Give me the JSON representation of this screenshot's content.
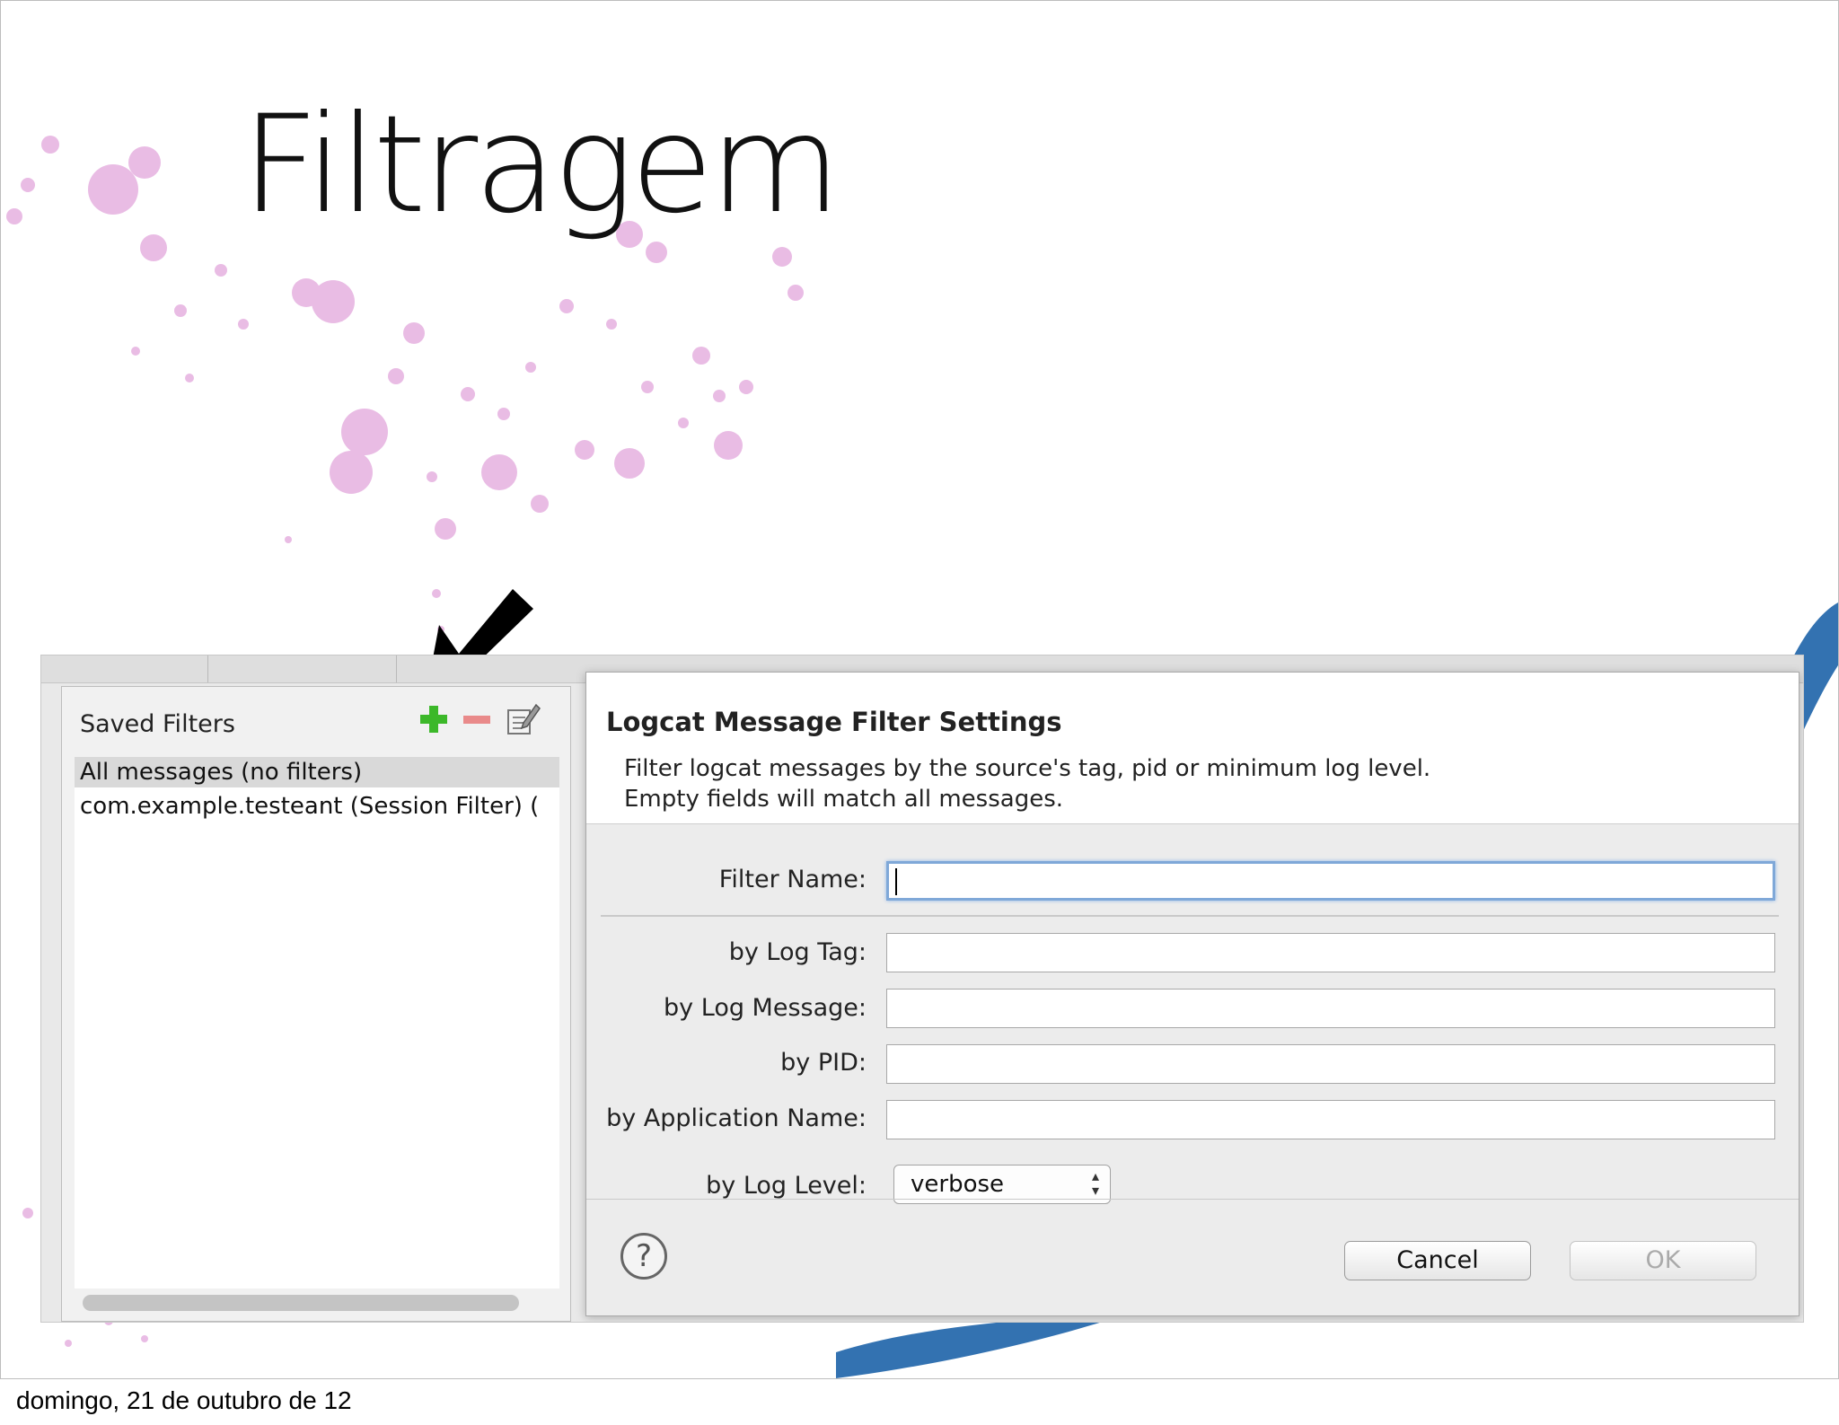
{
  "slide": {
    "title": "Filtragem",
    "footer": "domingo, 21 de outubro de 12"
  },
  "filters_panel": {
    "title": "Saved Filters",
    "tools": [
      {
        "icon": "add-filter-icon"
      },
      {
        "icon": "remove-filter-icon"
      },
      {
        "icon": "edit-filter-icon"
      }
    ],
    "items": [
      {
        "label": "All messages (no filters)",
        "selected": true
      },
      {
        "label": "com.example.testeant (Session Filter) (",
        "selected": false
      }
    ]
  },
  "dialog": {
    "title": "Logcat Message Filter Settings",
    "description_line1": "Filter logcat messages by the source's tag, pid or minimum log level.",
    "description_line2": "Empty fields will match all messages.",
    "filter_name_label": "Filter Name:",
    "filter_name_value": "",
    "log_tag_label": "by Log Tag:",
    "log_message_label": "by Log Message:",
    "pid_label": "by PID:",
    "app_name_label": "by Application Name:",
    "log_level_label": "by Log Level:",
    "log_level_value": "verbose",
    "help_glyph": "?",
    "cancel_label": "Cancel",
    "ok_label": "OK"
  },
  "colors": {
    "add_icon": "#3cb829",
    "remove_icon": "#e98a8a",
    "focus_ring": "#7fa8d8",
    "decor_pink": "#e2a6dc",
    "decor_blue": "#1d63a8"
  }
}
